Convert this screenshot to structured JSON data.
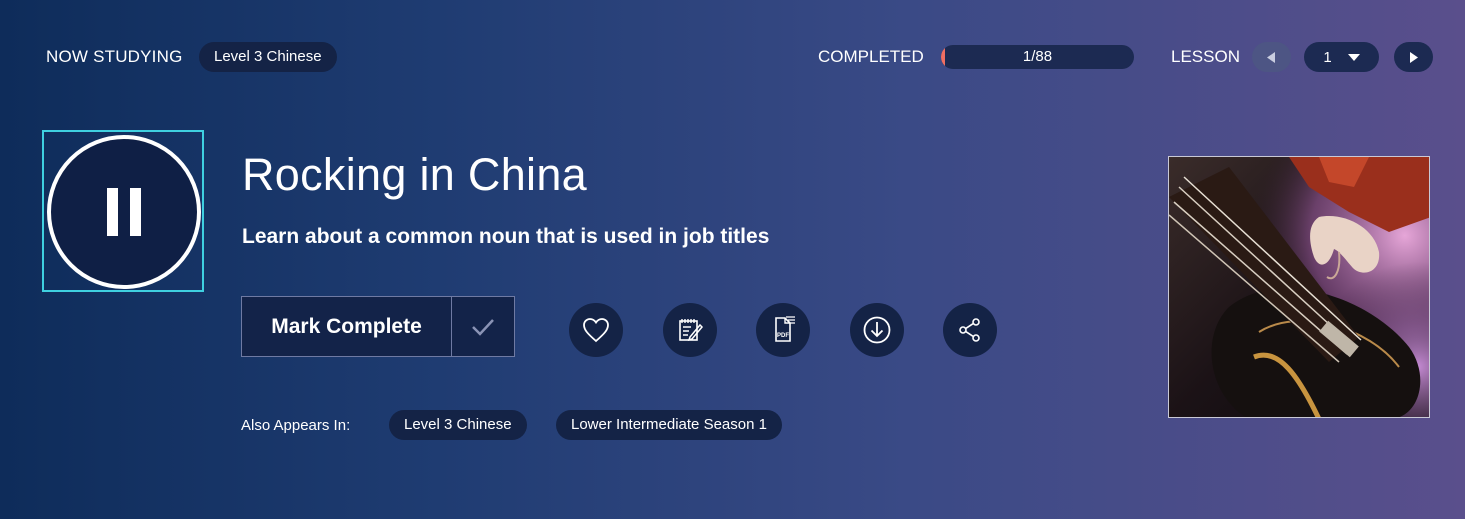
{
  "top_bar": {
    "now_studying_label": "NOW STUDYING",
    "now_studying_course": "Level 3 Chinese",
    "completed_label": "COMPLETED",
    "progress_text": "1/88",
    "progress_fraction": 0.011,
    "lesson_label": "LESSON",
    "lesson_number": "1",
    "prev_icon": "triangle-left-icon",
    "next_icon": "triangle-right-icon",
    "dropdown_icon": "caret-down-icon"
  },
  "player": {
    "state_icon": "pause-icon",
    "ring_color": "#3fd0e0"
  },
  "lesson": {
    "title": "Rocking in China",
    "subtitle": "Learn about a common noun that is used in job titles"
  },
  "actions": {
    "mark_complete_label": "Mark Complete",
    "check_icon": "checkmark-icon",
    "icons": [
      "heart-icon",
      "notepad-icon",
      "pdf-icon",
      "download-icon",
      "share-icon"
    ]
  },
  "also_appears": {
    "label": "Also Appears In:",
    "tags": [
      "Level 3 Chinese",
      "Lower Intermediate Season 1"
    ]
  },
  "thumbnail": {
    "subject": "bass guitar being played"
  },
  "colors": {
    "accent_progress": "#ef6e62",
    "pill_bg": "#142346",
    "player_focus": "#3fd0e0"
  }
}
